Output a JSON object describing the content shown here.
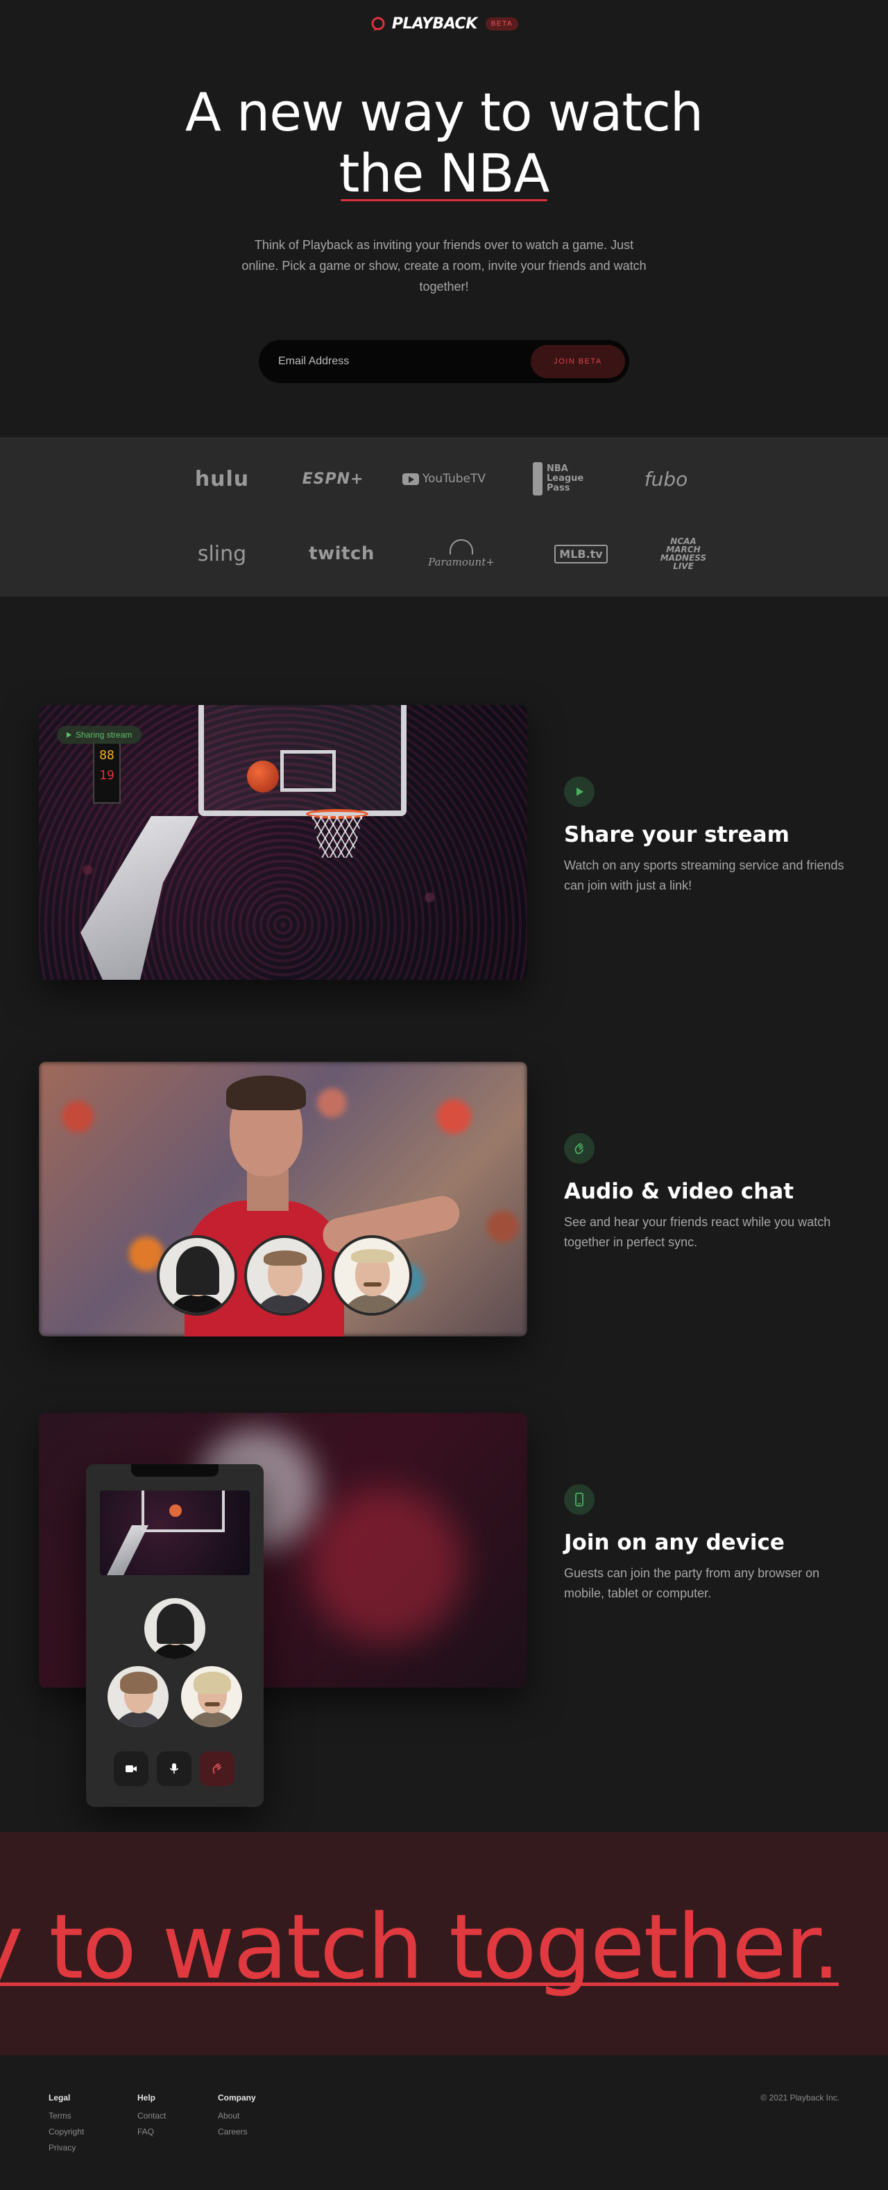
{
  "brand": {
    "name": "PLAYBACK",
    "badge": "BETA",
    "accent": "#e0303b"
  },
  "hero": {
    "title_line1": "A new way to watch",
    "title_line2": "the NBA",
    "description": "Think of Playback as inviting your friends over to watch a game. Just online. Pick a game or show, create a room, invite your friends and watch together!",
    "email_placeholder": "Email Address",
    "join_label": "JOIN BETA"
  },
  "services": {
    "row1": [
      "hulu",
      "ESPN+",
      "YouTubeTV",
      "NBA League Pass",
      "fubo"
    ],
    "row2": [
      "sling",
      "twitch",
      "Paramount+",
      "MLB.tv",
      "NCAA MARCH MADNESS LIVE"
    ]
  },
  "overlay": {
    "sharing_label": "Sharing stream",
    "score_top": "88",
    "score_bottom": "19"
  },
  "features": [
    {
      "icon": "play-icon",
      "title": "Share your stream",
      "description": "Watch on any sports streaming service and friends can join with just a link!"
    },
    {
      "icon": "wave-hand-icon",
      "title": "Audio & video chat",
      "description": "See and hear your friends react while you watch together in perfect sync."
    },
    {
      "icon": "phone-icon",
      "title": "Join on any device",
      "description": "Guests can join the party from any browser on mobile, tablet or computer."
    }
  ],
  "banner": {
    "text": "y to watch together."
  },
  "footer": {
    "legal": {
      "heading": "Legal",
      "links": [
        "Terms",
        "Copyright",
        "Privacy"
      ]
    },
    "help": {
      "heading": "Help",
      "links": [
        "Contact",
        "FAQ"
      ]
    },
    "company": {
      "heading": "Company",
      "links": [
        "About",
        "Careers"
      ]
    },
    "copyright": "© 2021 Playback Inc."
  }
}
